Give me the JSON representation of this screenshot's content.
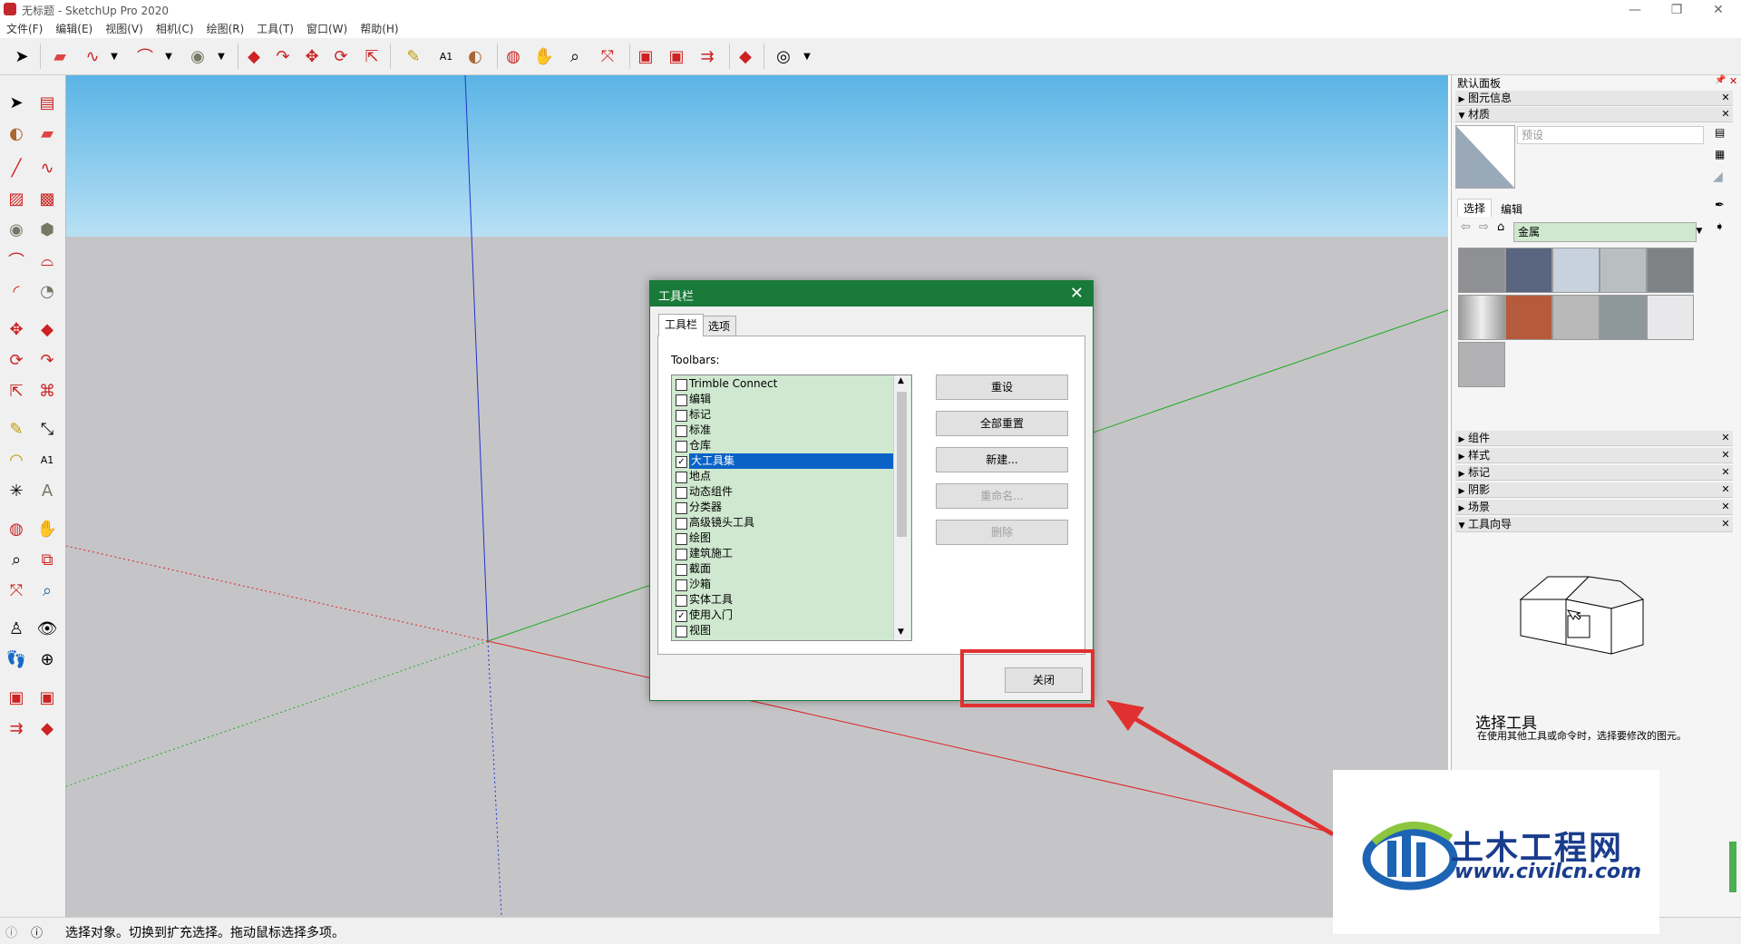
{
  "window": {
    "title": "无标题 - SketchUp Pro 2020"
  },
  "menu": [
    "文件(F)",
    "编辑(E)",
    "视图(V)",
    "相机(C)",
    "绘图(R)",
    "工具(T)",
    "窗口(W)",
    "帮助(H)"
  ],
  "dialog": {
    "title": "工具栏",
    "tabs": [
      "工具栏",
      "选项"
    ],
    "list_label": "Toolbars:",
    "items": [
      {
        "label": "Trimble Connect",
        "checked": false
      },
      {
        "label": "编辑",
        "checked": false
      },
      {
        "label": "标记",
        "checked": false
      },
      {
        "label": "标准",
        "checked": false
      },
      {
        "label": "仓库",
        "checked": false
      },
      {
        "label": "大工具集",
        "checked": true,
        "selected": true
      },
      {
        "label": "地点",
        "checked": false
      },
      {
        "label": "动态组件",
        "checked": false
      },
      {
        "label": "分类器",
        "checked": false
      },
      {
        "label": "高级镜头工具",
        "checked": false
      },
      {
        "label": "绘图",
        "checked": false
      },
      {
        "label": "建筑施工",
        "checked": false
      },
      {
        "label": "截面",
        "checked": false
      },
      {
        "label": "沙箱",
        "checked": false
      },
      {
        "label": "实体工具",
        "checked": false
      },
      {
        "label": "使用入门",
        "checked": true
      },
      {
        "label": "视图",
        "checked": false
      }
    ],
    "buttons": {
      "reset": "重设",
      "reset_all": "全部重置",
      "new": "新建...",
      "rename": "重命名...",
      "delete": "删除",
      "close": "关闭"
    }
  },
  "panel": {
    "title": "默认面板",
    "entity_info": "图元信息",
    "materials": "材质",
    "preset_placeholder": "预设",
    "tab_select": "选择",
    "tab_edit": "编辑",
    "collection": "金属",
    "sections": [
      "组件",
      "样式",
      "标记",
      "阴影",
      "场景"
    ],
    "instructor": "工具向导",
    "tool_title": "选择工具",
    "tool_desc": "在使用其他工具或命令时，选择要修改的图元。"
  },
  "status": {
    "text": "选择对象。切换到扩充选择。拖动鼠标选择多项。"
  },
  "watermark": {
    "brand": "土木工程网",
    "url": "www.civilcn.com"
  },
  "colors": {
    "dialog_green": "#1a7a3a",
    "list_bg": "#cfe8cf",
    "highlight_red": "#e03030",
    "selection_blue": "#0a62c7"
  },
  "materials_swatches": [
    "#8f9094",
    "#5a6680",
    "#c8d2de",
    "#b7bfc1",
    "#7e8285",
    "#c0c0c0",
    "#b65a3c",
    "#b9b9b9",
    "#8e979a",
    "#e8e8ea",
    "#b1b1b3"
  ]
}
